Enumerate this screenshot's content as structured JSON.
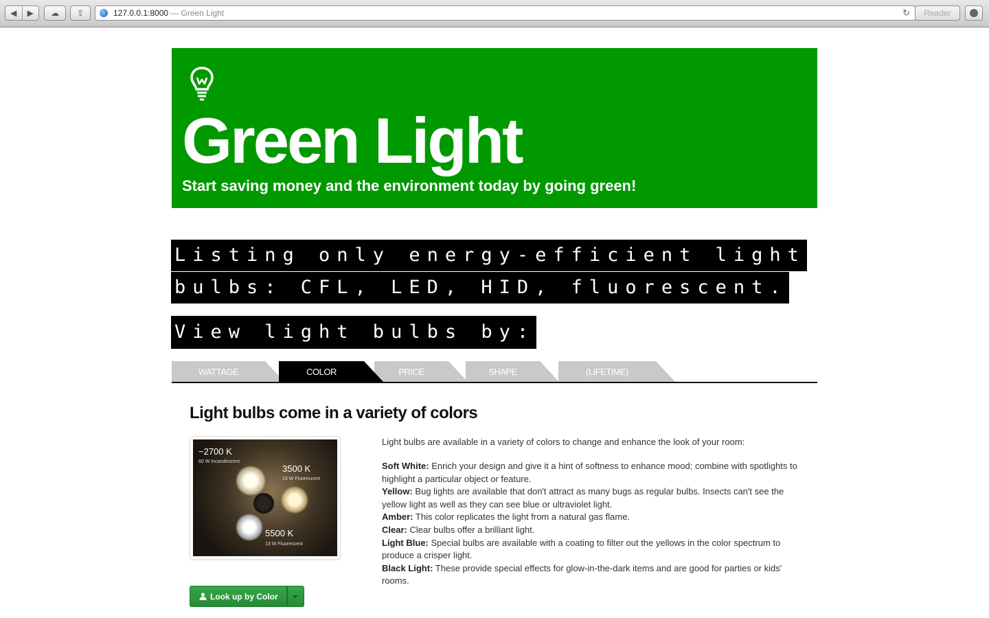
{
  "browser": {
    "url_host": "127.0.0.1:8000",
    "url_title": "— Green Light",
    "reader_label": "Reader"
  },
  "header": {
    "title": "Green Light",
    "subtitle": "Start saving money and the environment today by going green!"
  },
  "banner": {
    "line1": "Listing only energy-efficient light",
    "line2": "bulbs: CFL, LED, HID, fluorescent.",
    "line3": "View light bulbs by:"
  },
  "tabs": [
    {
      "label": "WATTAGE",
      "active": false
    },
    {
      "label": "COLOR",
      "active": true
    },
    {
      "label": "PRICE",
      "active": false
    },
    {
      "label": "SHAPE",
      "active": false
    },
    {
      "label": "(LIFETIME)",
      "active": false
    }
  ],
  "main": {
    "heading": "Light bulbs come in a variety of colors",
    "intro": "Light bulbs are available in a variety of colors to change and enhance the look of your room:",
    "photo_labels": [
      {
        "big": "~2700 K",
        "small": "60 W Incandescent"
      },
      {
        "big": "3500 K",
        "small": "13 W Fluorescent"
      },
      {
        "big": "5500 K",
        "small": "13 W Fluorescent"
      }
    ],
    "colors": [
      {
        "name": "Soft White:",
        "text": "Enrich your design and give it a hint of softness to enhance mood; combine with spotlights to highlight a particular object or feature."
      },
      {
        "name": "Yellow:",
        "text": "Bug lights are available that don't attract as many bugs as regular bulbs. Insects can't see the yellow light as well as they can see blue or ultraviolet light."
      },
      {
        "name": "Amber:",
        "text": "This color replicates the light from a natural gas flame."
      },
      {
        "name": "Clear:",
        "text": "Clear bulbs offer a brilliant light."
      },
      {
        "name": "Light Blue:",
        "text": "Special bulbs are available with a coating to filter out the yellows in the color spectrum to produce a crisper light."
      },
      {
        "name": "Black Light:",
        "text": "These provide special effects for glow-in-the-dark items and are good for parties or kids' rooms."
      }
    ],
    "button_label": "Look up by Color"
  },
  "colors": {
    "brand_green": "#009900",
    "button_green": "#2e9a41"
  }
}
